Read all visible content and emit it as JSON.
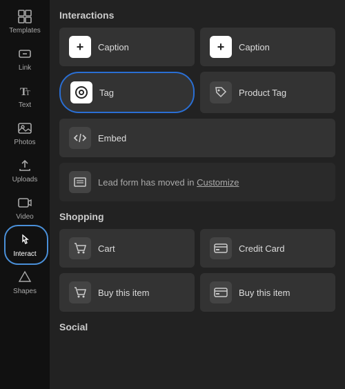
{
  "sidebar": {
    "items": [
      {
        "id": "templates",
        "label": "Templates",
        "icon": "grid"
      },
      {
        "id": "link",
        "label": "Link",
        "icon": "link"
      },
      {
        "id": "text",
        "label": "Text",
        "icon": "text"
      },
      {
        "id": "photos",
        "label": "Photos",
        "icon": "photo"
      },
      {
        "id": "uploads",
        "label": "Uploads",
        "icon": "upload"
      },
      {
        "id": "video",
        "label": "Video",
        "icon": "video"
      },
      {
        "id": "interact",
        "label": "Interact",
        "icon": "interact",
        "active": true
      },
      {
        "id": "shapes",
        "label": "Shapes",
        "icon": "shapes"
      }
    ]
  },
  "main": {
    "interactions_title": "Interactions",
    "shopping_title": "Shopping",
    "social_title": "Social",
    "tiles": {
      "caption1": "Caption",
      "caption2": "Caption",
      "tag": "Tag",
      "product_tag": "Product Tag",
      "embed": "Embed",
      "lead_form_text": "Lead form has moved in ",
      "lead_form_link": "Customize",
      "cart": "Cart",
      "credit_card": "Credit Card",
      "buy1": "Buy this item",
      "buy2": "Buy this item"
    }
  }
}
